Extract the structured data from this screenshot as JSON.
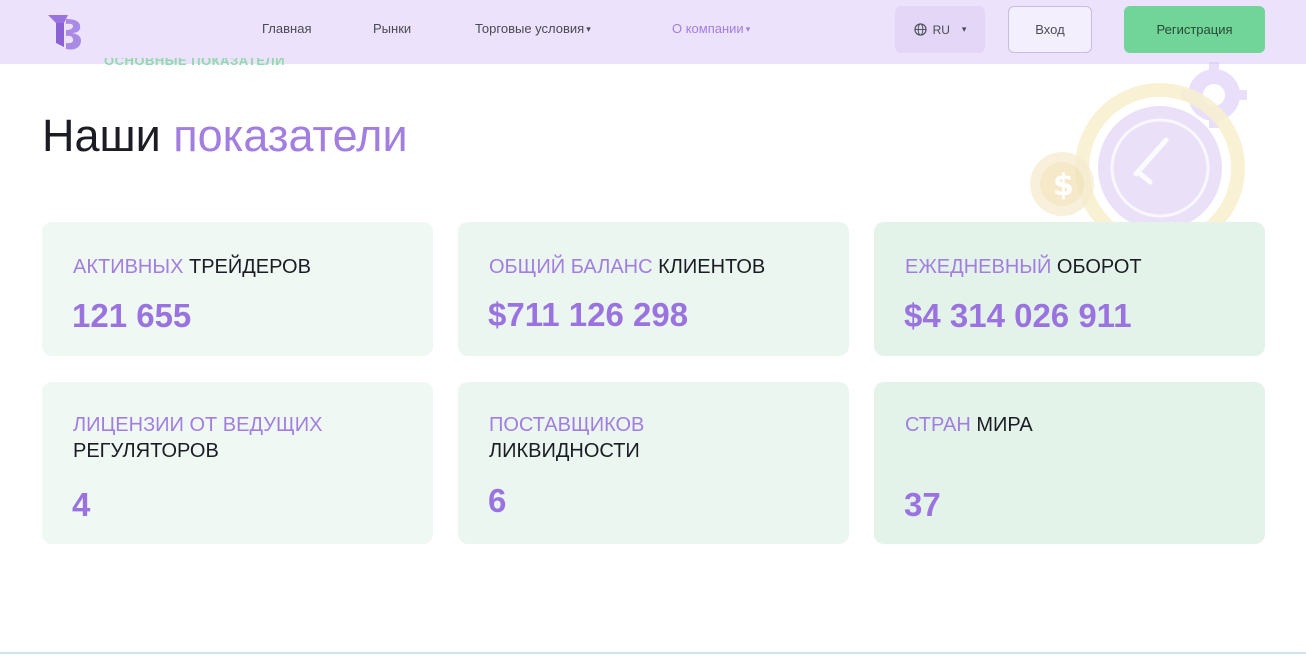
{
  "header": {
    "nav": [
      {
        "label": "Главная",
        "dropdown": false,
        "active": false
      },
      {
        "label": "Рынки",
        "dropdown": false,
        "active": false
      },
      {
        "label": "Торговые условия",
        "dropdown": true,
        "active": false
      },
      {
        "label": "О компании",
        "dropdown": true,
        "active": true
      }
    ],
    "lang": "RU",
    "login_label": "Вход",
    "register_label": "Регистрация"
  },
  "section": {
    "eyebrow": "ОСНОВНЫЕ ПОКАЗАТЕЛИ",
    "heading_plain": "Наши",
    "heading_accent": "показатели"
  },
  "stats": [
    {
      "title_accent": "АКТИВНЫХ",
      "title_plain": "ТРЕЙДЕРОВ",
      "value": "121 655"
    },
    {
      "title_accent": "ОБЩИЙ БАЛАНС",
      "title_plain": "КЛИЕНТОВ",
      "value": "$711 126 298"
    },
    {
      "title_accent": "ЕЖЕДНЕВНЫЙ",
      "title_plain": "ОБОРОТ",
      "value": "$4 314 026 911"
    },
    {
      "title_accent": "ЛИЦЕНЗИИ ОТ ВЕДУЩИХ",
      "title_plain": "РЕГУЛЯТОРОВ",
      "value": "4"
    },
    {
      "title_accent": "ПОСТАВЩИКОВ",
      "title_plain": "ЛИКВИДНОСТИ",
      "value": "6"
    },
    {
      "title_accent": "СТРАН",
      "title_plain": "МИРА",
      "value": "37"
    }
  ],
  "colors": {
    "accent": "#a27ee0",
    "header_bg": "#ece2fb",
    "register_bg": "#71d499",
    "card_bg_light": "#eff8f3",
    "card_bg_dark": "#e6f4ec"
  }
}
